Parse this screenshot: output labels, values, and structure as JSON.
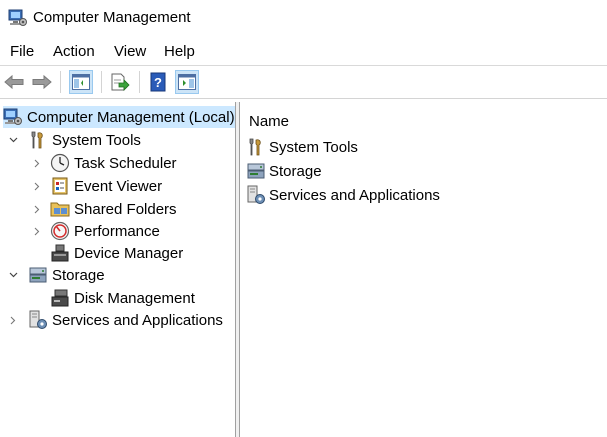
{
  "window": {
    "title": "Computer Management"
  },
  "menu": {
    "items": [
      "File",
      "Action",
      "View",
      "Help"
    ]
  },
  "toolbar": {
    "buttons": [
      {
        "name": "back",
        "icon": "back-arrow-icon"
      },
      {
        "name": "forward",
        "icon": "forward-arrow-icon"
      },
      {
        "name": "show-hide-console-tree",
        "icon": "console-tree-icon",
        "pressed": true
      },
      {
        "name": "export-list",
        "icon": "export-list-icon"
      },
      {
        "name": "help",
        "icon": "help-icon"
      },
      {
        "name": "show-hide-action-pane",
        "icon": "action-pane-icon",
        "pressed": true
      }
    ]
  },
  "tree": {
    "root": {
      "label": "Computer Management (Local)",
      "icon": "computer-management-icon",
      "selected": true
    },
    "items": [
      {
        "label": "System Tools",
        "icon": "system-tools-icon",
        "level": 1,
        "expander": "expanded"
      },
      {
        "label": "Task Scheduler",
        "icon": "task-scheduler-icon",
        "level": 2,
        "expander": "collapsed"
      },
      {
        "label": "Event Viewer",
        "icon": "event-viewer-icon",
        "level": 2,
        "expander": "collapsed"
      },
      {
        "label": "Shared Folders",
        "icon": "shared-folders-icon",
        "level": 2,
        "expander": "collapsed"
      },
      {
        "label": "Performance",
        "icon": "performance-icon",
        "level": 2,
        "expander": "collapsed"
      },
      {
        "label": "Device Manager",
        "icon": "device-manager-icon",
        "level": 2,
        "expander": "none"
      },
      {
        "label": "Storage",
        "icon": "storage-icon",
        "level": 1,
        "expander": "expanded"
      },
      {
        "label": "Disk Management",
        "icon": "disk-management-icon",
        "level": 2,
        "expander": "none"
      },
      {
        "label": "Services and Applications",
        "icon": "services-applications-icon",
        "level": 1,
        "expander": "collapsed"
      }
    ]
  },
  "list": {
    "column_header": "Name",
    "rows": [
      {
        "label": "System Tools",
        "icon": "system-tools-icon"
      },
      {
        "label": "Storage",
        "icon": "storage-icon"
      },
      {
        "label": "Services and Applications",
        "icon": "services-applications-icon"
      }
    ]
  },
  "colors": {
    "selection": "#cce8ff",
    "pressed_button": "#cce4f7",
    "splitter": "#f0f0f0"
  }
}
